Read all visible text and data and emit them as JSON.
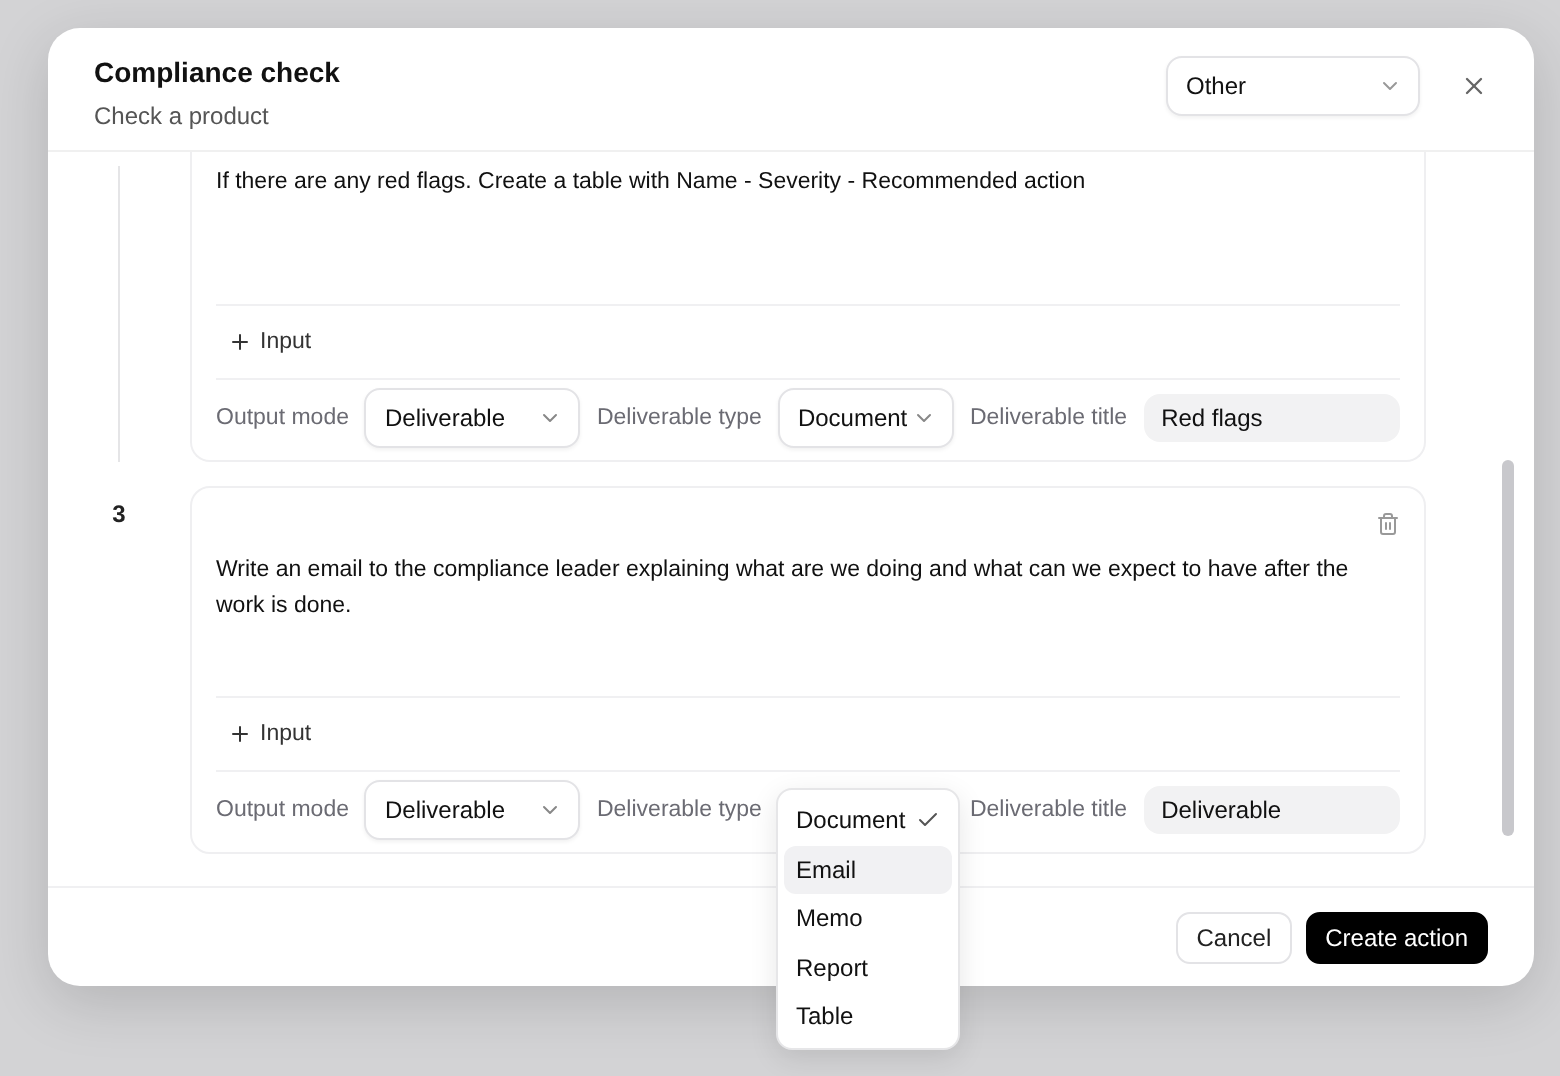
{
  "dialog": {
    "title": "Compliance check",
    "subtitle": "Check a product",
    "category_select": {
      "value": "Other"
    }
  },
  "steps": [
    {
      "prompt": "If there are any red flags. Create a table with Name - Severity - Recommended action",
      "input_button": "Input",
      "output_mode_label": "Output mode",
      "output_mode": "Deliverable",
      "deliverable_type_label": "Deliverable type",
      "deliverable_type": "Document",
      "deliverable_title_label": "Deliverable title",
      "deliverable_title": "Red flags",
      "menu_open": false
    },
    {
      "number": "3",
      "prompt": "Write an email to the compliance leader explaining what are we doing and what can we expect to have after the work is done.",
      "input_button": "Input",
      "output_mode_label": "Output mode",
      "output_mode": "Deliverable",
      "deliverable_type_label": "Deliverable type",
      "deliverable_title_label": "Deliverable title",
      "deliverable_title": "Deliverable",
      "menu_open": true
    }
  ],
  "type_menu": [
    {
      "label": "Document",
      "selected": true,
      "highlighted": false
    },
    {
      "label": "Email",
      "selected": false,
      "highlighted": true
    },
    {
      "label": "Memo",
      "selected": false,
      "highlighted": false
    },
    {
      "label": "Report",
      "selected": false,
      "highlighted": false
    },
    {
      "label": "Table",
      "selected": false,
      "highlighted": false
    }
  ],
  "footer": {
    "cancel": "Cancel",
    "create": "Create action"
  }
}
